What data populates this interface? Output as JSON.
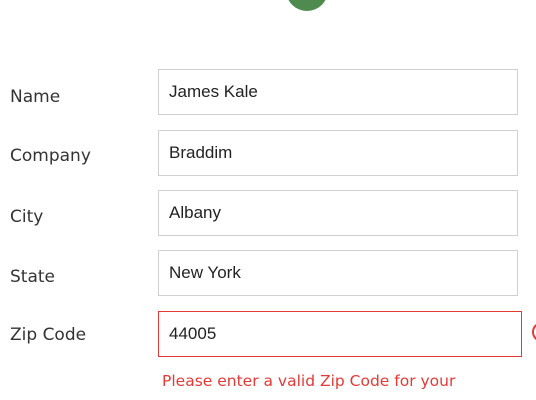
{
  "colors": {
    "accent": "#4f8a4f",
    "error": "#e53935",
    "field_border": "#d0d0d0",
    "label_text": "#333333"
  },
  "form": {
    "name": {
      "label": "Name",
      "value": "James Kale"
    },
    "company": {
      "label": "Company",
      "value": "Braddim"
    },
    "city": {
      "label": "City",
      "value": "Albany"
    },
    "state": {
      "label": "State",
      "value": "New York"
    },
    "zip": {
      "label": "Zip Code",
      "value": "44005",
      "error_message": "Please enter a valid Zip Code for your",
      "error_icon": "error-circle-icon"
    }
  }
}
